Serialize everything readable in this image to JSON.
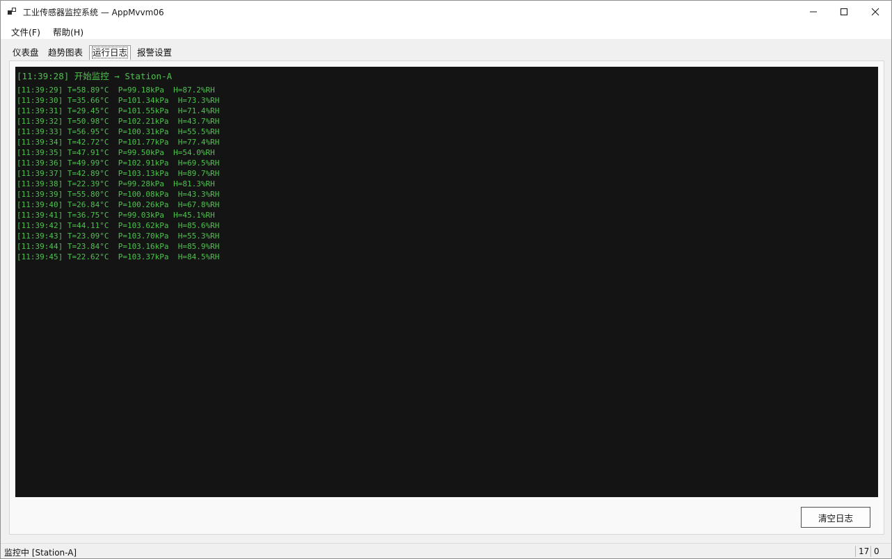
{
  "window": {
    "title": "工业传感器监控系统 — AppMvvm06",
    "icon": "app-window-icon",
    "controls": {
      "minimize": "minimize-icon",
      "maximize": "maximize-icon",
      "close": "close-icon"
    }
  },
  "menubar": {
    "items": [
      {
        "label": "文件(F)"
      },
      {
        "label": "帮助(H)"
      }
    ]
  },
  "tabs": [
    {
      "label": "仪表盘",
      "active": false
    },
    {
      "label": "趋势图表",
      "active": false
    },
    {
      "label": "运行日志",
      "active": true
    },
    {
      "label": "报警设置",
      "active": false
    }
  ],
  "log": {
    "header": "[11:39:28] 开始监控 → Station-A",
    "lines": [
      "[11:39:29] T=58.89°C  P=99.18kPa  H=87.2%RH",
      "[11:39:30] T=35.66°C  P=101.34kPa  H=73.3%RH",
      "[11:39:31] T=29.45°C  P=101.55kPa  H=71.4%RH",
      "[11:39:32] T=50.98°C  P=102.21kPa  H=43.7%RH",
      "[11:39:33] T=56.95°C  P=100.31kPa  H=55.5%RH",
      "[11:39:34] T=42.72°C  P=101.77kPa  H=77.4%RH",
      "[11:39:35] T=47.91°C  P=99.50kPa  H=54.0%RH",
      "[11:39:36] T=49.99°C  P=102.91kPa  H=69.5%RH",
      "[11:39:37] T=42.89°C  P=103.13kPa  H=89.7%RH",
      "[11:39:38] T=22.39°C  P=99.28kPa  H=81.3%RH",
      "[11:39:39] T=55.80°C  P=100.08kPa  H=43.3%RH",
      "[11:39:40] T=26.84°C  P=100.26kPa  H=67.8%RH",
      "[11:39:41] T=36.75°C  P=99.03kPa  H=45.1%RH",
      "[11:39:42] T=44.11°C  P=103.62kPa  H=85.6%RH",
      "[11:39:43] T=23.09°C  P=103.70kPa  H=55.3%RH",
      "[11:39:44] T=23.84°C  P=103.16kPa  H=85.9%RH",
      "[11:39:45] T=22.62°C  P=103.37kPa  H=84.5%RH"
    ],
    "text_color": "#4ec24e",
    "background": "#141414"
  },
  "actions": {
    "clear_label": "清空日志"
  },
  "statusbar": {
    "text": "监控中 [Station-A]",
    "count": "17",
    "errors": "0"
  }
}
